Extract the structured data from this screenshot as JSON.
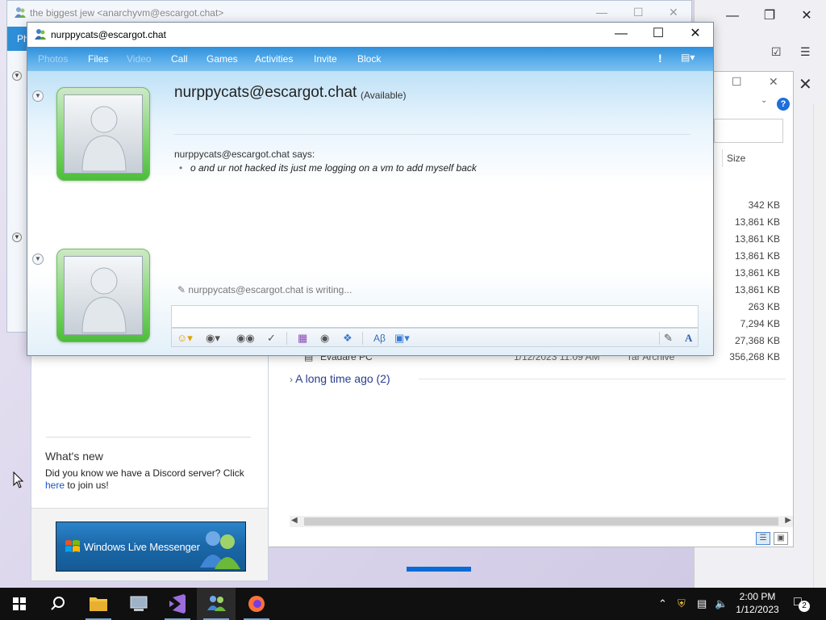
{
  "background_window": {
    "title": "the biggest jew <anarchyvm@escargot.chat>",
    "tab_label": "Ph"
  },
  "contact_list": {
    "whats_new_heading": "What's new",
    "news_text": "Did you know we have a Discord server? Click ",
    "news_link": "here",
    "news_text_end": " to join us!",
    "banner_text": "Windows Live Messenger"
  },
  "file_explorer": {
    "size_header": "Size",
    "sizes": [
      "342 KB",
      "13,861 KB",
      "13,861 KB",
      "13,861 KB",
      "13,861 KB",
      "13,861 KB",
      "263 KB",
      "7,294 KB",
      "27,368 KB"
    ],
    "last_row": {
      "name": "Evadare PC",
      "date": "1/12/2023 11:09 AM",
      "type": "rar Archive",
      "size": "356,268 KB"
    },
    "group_label": "A long time ago (2)"
  },
  "chat_window": {
    "title": "nurppycats@escargot.chat",
    "menu": [
      {
        "label": "Photos",
        "enabled": false
      },
      {
        "label": "Files",
        "enabled": true
      },
      {
        "label": "Video",
        "enabled": false
      },
      {
        "label": "Call",
        "enabled": true
      },
      {
        "label": "Games",
        "enabled": true
      },
      {
        "label": "Activities",
        "enabled": true
      },
      {
        "label": "Invite",
        "enabled": true
      },
      {
        "label": "Block",
        "enabled": true
      }
    ],
    "contact_name": "nurppycats@escargot.chat",
    "contact_status": "(Available)",
    "says_line": "nurppycats@escargot.chat says:",
    "message": "o and ur not hacked its just me logging on a vm to add myself back",
    "writing_status": "nurppycats@escargot.chat is writing...",
    "input_value": ""
  },
  "taskbar": {
    "clock_time": "2:00 PM",
    "clock_date": "1/12/2023",
    "notification_count": "2"
  },
  "colors": {
    "menubar_top": "#2f8fd9",
    "menubar_bottom": "#7cc0f0",
    "avatar_green": "#4dbd3b",
    "taskbar": "#101010"
  }
}
